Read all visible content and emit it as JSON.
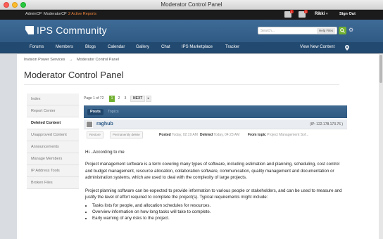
{
  "window": {
    "title": "Moderator Control Panel"
  },
  "adminbar": {
    "admincp": "AdminCP",
    "modcp": "ModeratorCP",
    "reports": "2 Active Reports",
    "notif_count_1": "1",
    "notif_count_2": "3",
    "user": "Rikki",
    "signout": "Sign Out"
  },
  "header": {
    "brand": "IPS Community",
    "search_placeholder": "Search...",
    "search_scope": "Help Files"
  },
  "nav": {
    "items": [
      "Forums",
      "Members",
      "Blogs",
      "Calendar",
      "Gallery",
      "Chat",
      "IPS Marketplace",
      "Tracker"
    ],
    "view_new": "View New Content"
  },
  "breadcrumb": {
    "root": "Invision Power Services",
    "arrow": "→",
    "current": "Moderator Control Panel"
  },
  "page_title": "Moderator Control Panel",
  "sidebar": {
    "items": [
      "Index",
      "Report Center",
      "Deleted Content",
      "Unapproved Content",
      "Announcements",
      "Manage Members",
      "IP Address Tools",
      "Broken Files"
    ],
    "active_index": 2
  },
  "pager": {
    "label": "Page 1 of 72",
    "pages": [
      "1",
      "2",
      "3"
    ],
    "next": "NEXT",
    "more": "▸"
  },
  "tabs": {
    "posts": "Posts",
    "topics": "Topics"
  },
  "post": {
    "author": "raghub",
    "ip": "(IP: 122.178.173.76 )",
    "restore": "Restore",
    "perm_delete": "Permanently delete",
    "posted_label": "Posted",
    "posted_time": "Today, 02:19 AM",
    "deleted_label": "Deleted",
    "deleted_time": "Today, 04:23 AM",
    "from_label": "From topic",
    "from_topic": "Project Management Sof...",
    "greeting": "Hi...According to me",
    "para1": "Project management software is a term covering many types of software, including estimation and planning, scheduling, cost control and budget management, resource allocation, collaboration software, communication, quality management and documentation or administration systems, which are used to deal with the complexity of large projects.",
    "para2": "Project planning software can be expected to provide information to various people or stakeholders, and can be used to measure and justify the level of effort required to complete the project(s). Typical requirements might include:",
    "bullets": [
      "Tasks lists for people, and allocation schedules for resources.",
      "Overview information on how long tasks will take to complete.",
      "Early warning of any risks to the project."
    ]
  }
}
